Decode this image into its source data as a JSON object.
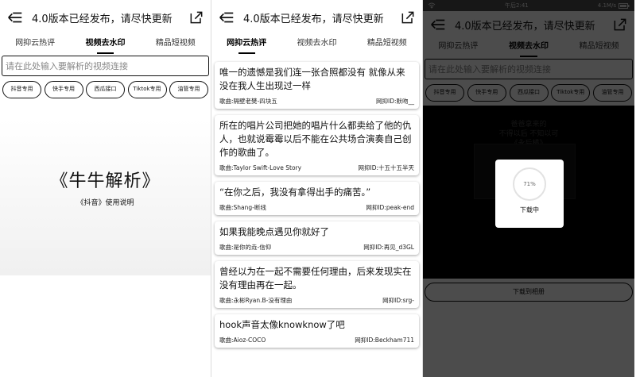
{
  "header": {
    "title": "4.0版本已经发布，请尽快更新"
  },
  "tabs": [
    "网抑云热评",
    "视频去水印",
    "精品短视频"
  ],
  "search": {
    "placeholder": "请在此处输入要解析的视频连接"
  },
  "chips": [
    "抖音专用",
    "快手专用",
    "西瓜接口",
    "Tiktok专用",
    "油管专用"
  ],
  "hero": {
    "title": "《牛牛解析》",
    "subtitle": "《抖音》使用说明"
  },
  "comments": [
    {
      "text": "唯一的遗憾是我们连一张合照都没有 就像从来没在我人生出现过一样",
      "song": "歌曲:隔壁老樊-四块五",
      "user": "网抑ID:默吻__"
    },
    {
      "text": "所在的唱片公司把她的唱片什么都卖给了他的仇人，也就说霉霉以后不能在公共场合演奏自己创作的歌曲了。",
      "song": "歌曲:Taylor Swift-Love Story",
      "user": "网抑ID:十五十五半天"
    },
    {
      "text": "“在你之后，我没有拿得出手的痛苦。”",
      "song": "歌曲:Shang-断线",
      "user": "网抑ID:peak-end"
    },
    {
      "text": "如果我能晚点遇见你就好了",
      "song": "歌曲:是你的垚-信仰",
      "user": "网抑ID:再见_d3GL"
    },
    {
      "text": "曾经以为在一起不需要任何理由，后来发现实在没有理由再在一起。",
      "song": "歌曲:永彬Ryan.B-没有理由",
      "user": "网抑ID:srg-"
    },
    {
      "text": "hook声音太像knowknow了吧",
      "song": "歌曲:Aioz-COCO",
      "user": "网抑ID:Beckham711"
    }
  ],
  "statusbar": {
    "time": "午后2:41",
    "right": "4.1M/s"
  },
  "video": {
    "overlay_lines": [
      "爸爸拿来的",
      "不得以后 不知以可",
      "《永后橘》"
    ]
  },
  "download": {
    "percent": "71%",
    "label": "下载中",
    "button": "下载到相册"
  }
}
